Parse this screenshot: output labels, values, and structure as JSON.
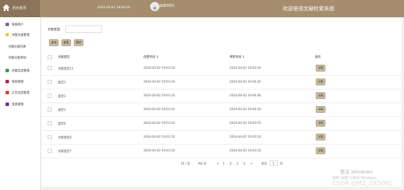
{
  "header": {
    "brand_label": "后台首页",
    "datetime": "2024-04-02 19:00:24",
    "username": "admin",
    "app_title": "欢迎使用文献检索系统",
    "colors": {
      "bar": "#a58d6e",
      "brand": "#8a7358"
    }
  },
  "sidebar": {
    "items": [
      {
        "label": "系统用户",
        "icon": "user-icon",
        "color": "#7b5ea7"
      },
      {
        "label": "文献分类管理",
        "icon": "folder-icon",
        "color": "#f0c419"
      },
      {
        "label": "文献分类列表",
        "sub": true
      },
      {
        "label": "文献分类添加",
        "sub": true
      },
      {
        "label": "文献信息管理",
        "icon": "book-icon",
        "color": "#2ea043"
      },
      {
        "label": "系统管理",
        "icon": "system-icon",
        "color": "#c2185b"
      },
      {
        "label": "公告信息管理",
        "icon": "notice-icon",
        "color": "#e53935"
      },
      {
        "label": "资源管理",
        "icon": "resource-icon",
        "color": "#7b1fa2"
      }
    ]
  },
  "filter": {
    "label": "文献类型:",
    "value": "",
    "placeholder": ""
  },
  "buttons": {
    "search": "查询",
    "reset": "重置",
    "delete": "删除"
  },
  "table": {
    "headers": [
      "文献类型",
      "创建时间 ↕",
      "更新时间 ↕",
      "操作"
    ],
    "rows": [
      {
        "type": "文献类型12",
        "created": "2024-04-02 19:03:10",
        "updated": "2024-04-02 19:03:10",
        "action": "详情"
      },
      {
        "type": "类型2",
        "created": "2024-04-02 19:03:10",
        "updated": "2024-04-02 19:04:42",
        "action": "详情"
      },
      {
        "type": "类型3",
        "created": "2024-04-02 19:03:10",
        "updated": "2024-04-02 19:04:46",
        "action": "详情"
      },
      {
        "type": "类型5",
        "created": "2024-04-02 19:03:10",
        "updated": "2024-04-02 19:04:50",
        "action": "详情"
      },
      {
        "type": "类型6",
        "created": "2024-04-02 19:03:10",
        "updated": "2024-04-02 19:03:55",
        "action": "详情"
      },
      {
        "type": "文献类型6",
        "created": "2024-04-02 19:03:10",
        "updated": "2024-04-02 19:03:10",
        "action": "详情"
      },
      {
        "type": "文献类型7",
        "created": "2024-04-02 19:03:10",
        "updated": "2024-04-02 19:03:10",
        "action": "详情"
      }
    ]
  },
  "pagination": {
    "page_size": "10 / 页",
    "total": "共6 页",
    "prev": "<",
    "pages": [
      "1",
      "2",
      "3",
      "4"
    ],
    "current_page": "2",
    "next": ">",
    "goto_label": "前往",
    "goto_value": "1",
    "goto_suffix": "页"
  },
  "watermark": {
    "activate_title": "激活 Windows",
    "activate_hint": "转到\"设置\"以激活 Windows。",
    "csdn": "CSDN @MZ_ZXD001"
  }
}
